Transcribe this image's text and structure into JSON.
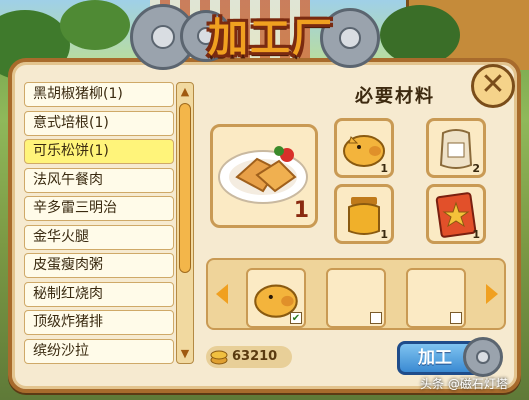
{
  "header": {
    "title": "加工厂"
  },
  "recipe_list": {
    "items": [
      {
        "label": "黑胡椒猪柳(1)",
        "selected": false
      },
      {
        "label": "意式培根(1)",
        "selected": false
      },
      {
        "label": "可乐松饼(1)",
        "selected": true
      },
      {
        "label": "法风午餐肉",
        "selected": false
      },
      {
        "label": "辛多雷三明治",
        "selected": false
      },
      {
        "label": "金华火腿",
        "selected": false
      },
      {
        "label": "皮蛋瘦肉粥",
        "selected": false
      },
      {
        "label": "秘制红烧肉",
        "selected": false
      },
      {
        "label": "顶级炸猪排",
        "selected": false
      },
      {
        "label": "缤纷沙拉",
        "selected": false
      }
    ]
  },
  "materials": {
    "section_label": "必要材料",
    "product": {
      "icon": "waffle-plate-icon",
      "qty": "1"
    },
    "items": [
      {
        "icon": "pig-icon",
        "qty": "1"
      },
      {
        "icon": "flour-sack-icon",
        "qty": "2"
      },
      {
        "icon": "honey-jar-icon",
        "qty": "1"
      },
      {
        "icon": "star-card-icon",
        "qty": "1"
      }
    ]
  },
  "craft_slots": {
    "slots": [
      {
        "icon": "pig-icon",
        "checked": true,
        "check_mark": "✔"
      },
      {
        "icon": "",
        "checked": false,
        "check_mark": ""
      },
      {
        "icon": "",
        "checked": false,
        "check_mark": ""
      }
    ]
  },
  "footer": {
    "coins": "63210",
    "craft_button_label": "加工"
  },
  "watermark": "头条 @磁石灯塔",
  "colors": {
    "accent": "#f0a020",
    "panel": "#f6ead0",
    "button": "#3a8ad2"
  }
}
